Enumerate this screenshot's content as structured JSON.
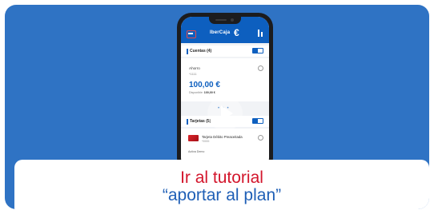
{
  "app": {
    "brand": "IberCaja",
    "brand_mark": "€"
  },
  "accounts_section": {
    "title": "Cuentas (4)"
  },
  "account": {
    "name": "Ahorro",
    "number": "*1111",
    "amount": "100,00 €",
    "available_label": "Disponible:",
    "available_value": "100,00 €"
  },
  "cards_section": {
    "title": "Tarjetas (5)"
  },
  "card_item": {
    "name": "Tarjeta Débito Preaceitada",
    "sub": "*5555",
    "status": "Activa Demo"
  },
  "cta": {
    "line1": "Ir al tutorial",
    "line2": "“aportar al plan”"
  },
  "colors": {
    "background": "#2f73c4",
    "app_blue": "#0d5fbf",
    "cta_red": "#d3162c",
    "cta_blue": "#1f5fb6"
  }
}
